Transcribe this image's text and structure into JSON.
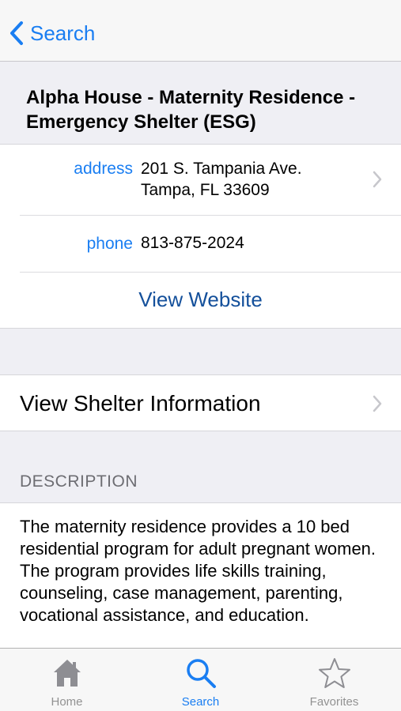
{
  "navbar": {
    "back_label": "Search"
  },
  "shelter": {
    "title": "Alpha House - Maternity Residence - Emergency Shelter (ESG)"
  },
  "contact": {
    "address_label": "address",
    "address_line1": "201 S. Tampania Ave.",
    "address_line2": "Tampa, FL 33609",
    "phone_label": "phone",
    "phone_value": "813-875-2024",
    "website_label": "View Website"
  },
  "shelter_info": {
    "label": "View Shelter Information"
  },
  "description": {
    "header": "DESCRIPTION",
    "text": "The maternity residence provides a 10 bed residential program for adult pregnant women.  The program provides life skills training, counseling, case management, parenting, vocational assistance, and education."
  },
  "tabbar": {
    "active": "Search",
    "items": [
      {
        "label": "Home",
        "icon": "home-icon"
      },
      {
        "label": "Search",
        "icon": "search-icon"
      },
      {
        "label": "Favorites",
        "icon": "star-icon"
      }
    ]
  },
  "colors": {
    "accent": "#1a7ef2",
    "link": "#14509b",
    "inactive": "#929292"
  }
}
